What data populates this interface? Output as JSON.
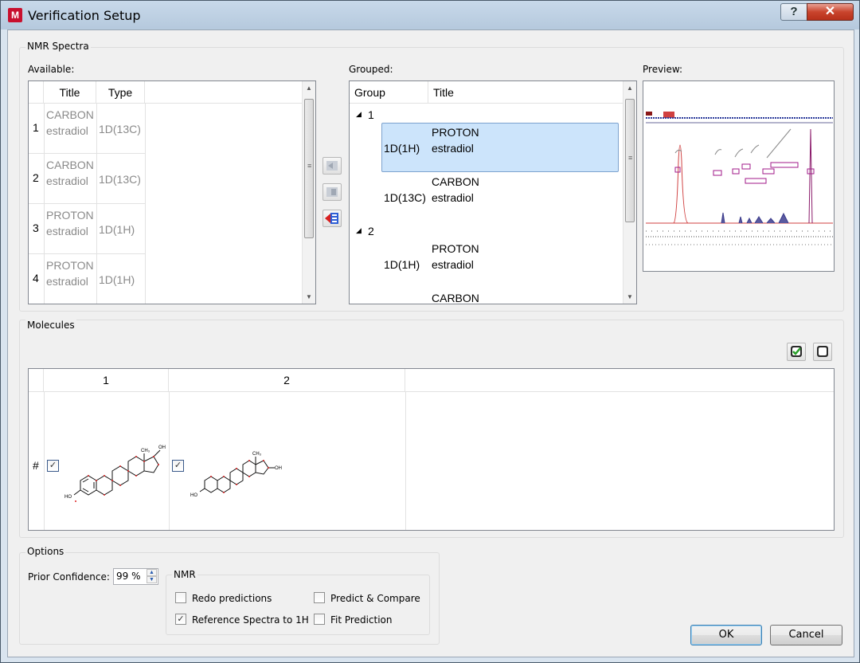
{
  "window": {
    "title": "Verification Setup",
    "help_label": "?",
    "close_label": "✕"
  },
  "nmr_spectra": {
    "group_title": "NMR Spectra",
    "available": {
      "label": "Available:",
      "columns": [
        "Title",
        "Type"
      ],
      "rows": [
        {
          "num": "1",
          "title1": "CARBON",
          "title2": "estradiol",
          "type": "1D(13C)"
        },
        {
          "num": "2",
          "title1": "CARBON",
          "title2": "estradiol",
          "type": "1D(13C)"
        },
        {
          "num": "3",
          "title1": "PROTON",
          "title2": "estradiol",
          "type": "1D(1H)"
        },
        {
          "num": "4",
          "title1": "PROTON",
          "title2": "estradiol",
          "type": "1D(1H)"
        }
      ]
    },
    "grouped": {
      "label": "Grouped:",
      "columns": [
        "Group",
        "Title"
      ],
      "groups": [
        {
          "id": "1",
          "items": [
            {
              "type": "1D(1H)",
              "title1": "PROTON",
              "title2": "estradiol",
              "selected": true
            },
            {
              "type": "1D(13C)",
              "title1": "CARBON",
              "title2": "estradiol",
              "selected": false
            }
          ]
        },
        {
          "id": "2",
          "items": [
            {
              "type": "1D(1H)",
              "title1": "PROTON",
              "title2": "estradiol",
              "selected": false
            },
            {
              "type": "",
              "title1": "CARBON",
              "title2": "",
              "selected": false
            }
          ]
        }
      ]
    },
    "preview": {
      "label": "Preview:"
    }
  },
  "molecules": {
    "group_title": "Molecules",
    "columns": [
      "1",
      "2"
    ],
    "row_label": "#",
    "checked": [
      true,
      true
    ]
  },
  "options": {
    "group_title": "Options",
    "prior_confidence_label": "Prior Confidence:",
    "prior_confidence_value": "99 %",
    "nmr": {
      "title": "NMR",
      "redo_predictions": {
        "label": "Redo predictions",
        "checked": false
      },
      "predict_compare": {
        "label": "Predict & Compare",
        "checked": false
      },
      "reference_spectra": {
        "label": "Reference Spectra to 1H",
        "checked": true
      },
      "fit_prediction": {
        "label": "Fit Prediction",
        "checked": false
      }
    }
  },
  "buttons": {
    "ok": "OK",
    "cancel": "Cancel"
  },
  "colors": {
    "selection": "#cce4fb",
    "accent": "#c8102e"
  }
}
